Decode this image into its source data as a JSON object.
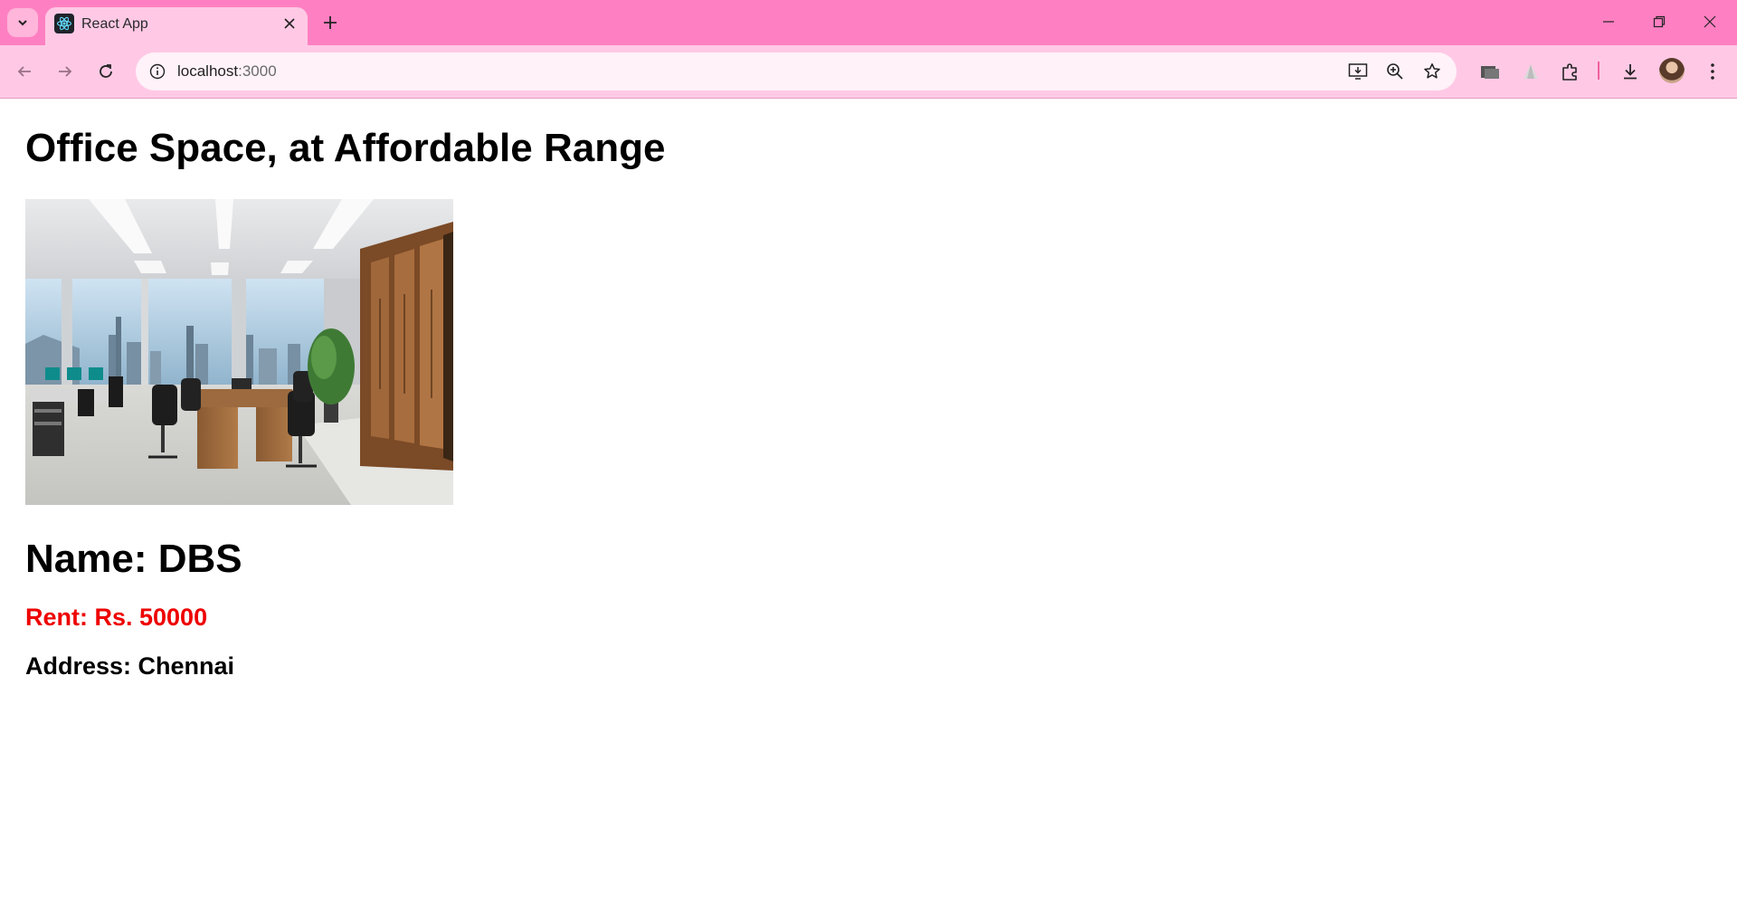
{
  "browser": {
    "tab_title": "React App",
    "url_host": "localhost",
    "url_port": ":3000",
    "theme_color": "#ff80c2",
    "toolbar_color": "#ffc9e5"
  },
  "icons": {
    "tab_search": "chevron-down-icon",
    "favicon": "react-logo-icon",
    "tab_close": "close-icon",
    "new_tab": "plus-icon",
    "back": "arrow-left-icon",
    "forward": "arrow-right-icon",
    "reload": "reload-icon",
    "site_info": "info-icon",
    "install": "install-app-icon",
    "zoom": "zoom-icon",
    "bookmark": "star-icon",
    "extensions": "puzzle-icon",
    "downloads": "download-icon",
    "menu": "kebab-menu-icon"
  },
  "page": {
    "title": "Office Space, at Affordable Range",
    "image_alt": "Office interior with desks, chairs and city view",
    "name_label": "Name: DBS",
    "rent_label": "Rent: Rs. 50000",
    "rent_color": "#ee0000",
    "address_label": "Address: Chennai"
  }
}
